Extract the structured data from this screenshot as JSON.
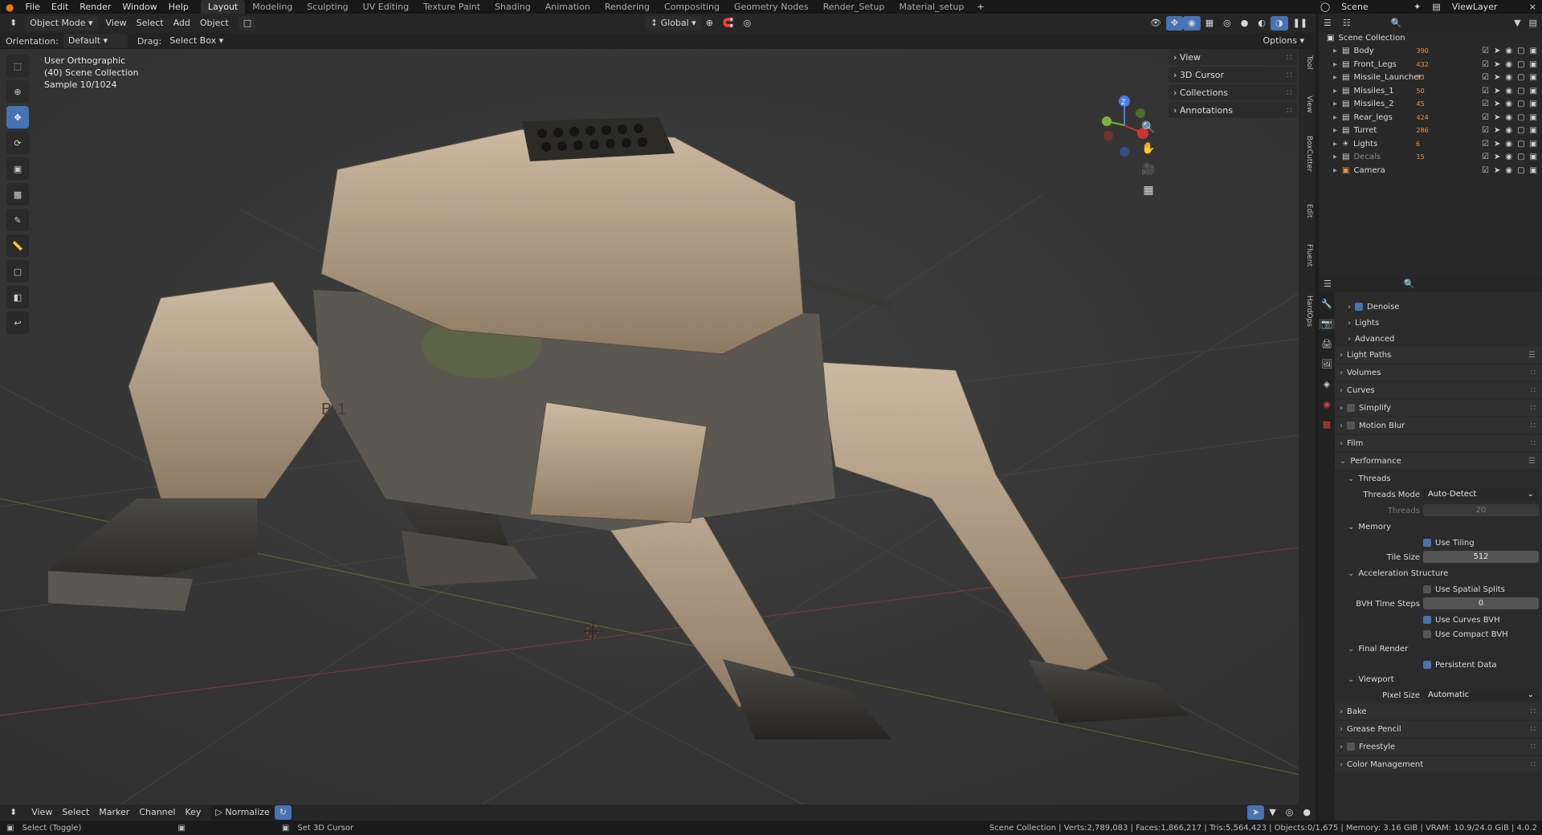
{
  "menus": [
    "File",
    "Edit",
    "Render",
    "Window",
    "Help"
  ],
  "workspace_tabs": [
    {
      "label": "Layout",
      "active": true
    },
    {
      "label": "Modeling"
    },
    {
      "label": "Sculpting"
    },
    {
      "label": "UV Editing"
    },
    {
      "label": "Texture Paint"
    },
    {
      "label": "Shading"
    },
    {
      "label": "Animation"
    },
    {
      "label": "Rendering"
    },
    {
      "label": "Compositing"
    },
    {
      "label": "Geometry Nodes"
    },
    {
      "label": "Render_Setup"
    },
    {
      "label": "Material_setup"
    }
  ],
  "scene_name": "Scene",
  "view_layer": "ViewLayer",
  "header": {
    "mode": "Object Mode",
    "menus": [
      "View",
      "Select",
      "Add",
      "Object"
    ],
    "transform": "Global",
    "options": "Options"
  },
  "header2": {
    "orientation_label": "Orientation:",
    "orientation_value": "Default",
    "drag_label": "Drag:",
    "drag_value": "Select Box"
  },
  "viewport": {
    "view_name": "User Orthographic",
    "collection": "(40) Scene Collection",
    "sample": "Sample 10/1024",
    "decal_text": "B-1",
    "gizmo_axis": "Z",
    "accent": "#4772b3"
  },
  "npanel": [
    "View",
    "3D Cursor",
    "Collections",
    "Annotations"
  ],
  "side_tabs": [
    "Tool",
    "View",
    "BoxCutter",
    "Edit",
    "Fluent",
    "HardOps"
  ],
  "outliner": {
    "root": "Scene Collection",
    "items": [
      {
        "name": "Body",
        "count": "390"
      },
      {
        "name": "Front_Legs",
        "count": "432"
      },
      {
        "name": "Missile_Launcher",
        "count": "73"
      },
      {
        "name": "Missiles_1",
        "count": "50"
      },
      {
        "name": "Missiles_2",
        "count": "45"
      },
      {
        "name": "Rear_legs",
        "count": "424"
      },
      {
        "name": "Turret",
        "count": "286"
      },
      {
        "name": "Lights",
        "count": "6"
      },
      {
        "name": "Decals",
        "count": "15"
      },
      {
        "name": "Camera",
        "count": ""
      }
    ]
  },
  "properties": {
    "rows": [
      {
        "type": "sub",
        "label": "Denoise",
        "checkbox": true,
        "checked": true
      },
      {
        "type": "sub",
        "label": "Lights"
      },
      {
        "type": "sub",
        "label": "Advanced"
      },
      {
        "type": "section",
        "label": "Light Paths",
        "list": true
      },
      {
        "type": "section",
        "label": "Volumes"
      },
      {
        "type": "section",
        "label": "Curves"
      },
      {
        "type": "section",
        "label": "Simplify",
        "checkbox": true
      },
      {
        "type": "section",
        "label": "Motion Blur",
        "checkbox": true
      },
      {
        "type": "section",
        "label": "Film"
      },
      {
        "type": "section",
        "label": "Performance",
        "open": true,
        "list": true
      },
      {
        "type": "sub",
        "label": "Threads",
        "open": true
      },
      {
        "type": "field",
        "label": "Threads Mode",
        "value": "Auto-Detect",
        "dropdown": true
      },
      {
        "type": "field",
        "label": "Threads",
        "value": "20",
        "disabled": true
      },
      {
        "type": "sub",
        "label": "Memory",
        "open": true
      },
      {
        "type": "check",
        "label": "Use Tiling",
        "checked": true
      },
      {
        "type": "field",
        "label": "Tile Size",
        "value": "512"
      },
      {
        "type": "sub",
        "label": "Acceleration Structure",
        "open": true
      },
      {
        "type": "check",
        "label": "Use Spatial Splits",
        "checked": false
      },
      {
        "type": "field",
        "label": "BVH Time Steps",
        "value": "0"
      },
      {
        "type": "check",
        "label": "Use Curves BVH",
        "checked": true
      },
      {
        "type": "check",
        "label": "Use Compact BVH",
        "checked": false
      },
      {
        "type": "sub",
        "label": "Final Render",
        "open": true
      },
      {
        "type": "check",
        "label": "Persistent Data",
        "checked": true
      },
      {
        "type": "sub",
        "label": "Viewport",
        "open": true
      },
      {
        "type": "field",
        "label": "Pixel Size",
        "value": "Automatic",
        "dropdown": true
      },
      {
        "type": "section",
        "label": "Bake"
      },
      {
        "type": "section",
        "label": "Grease Pencil"
      },
      {
        "type": "section",
        "label": "Freestyle",
        "checkbox": true
      },
      {
        "type": "section",
        "label": "Color Management"
      }
    ]
  },
  "timeline": {
    "menus": [
      "View",
      "Select",
      "Marker",
      "Channel",
      "Key"
    ],
    "normalize": "Normalize"
  },
  "status": {
    "left": "Select (Toggle)",
    "middle": "Set 3D Cursor",
    "stats": "Scene Collection | Verts:2,789,083 | Faces:1,866,217 | Tris:5,564,423 | Objects:0/1,675 | Memory: 3.16 GiB | VRAM: 10.9/24.0 GiB | 4.0.2"
  }
}
